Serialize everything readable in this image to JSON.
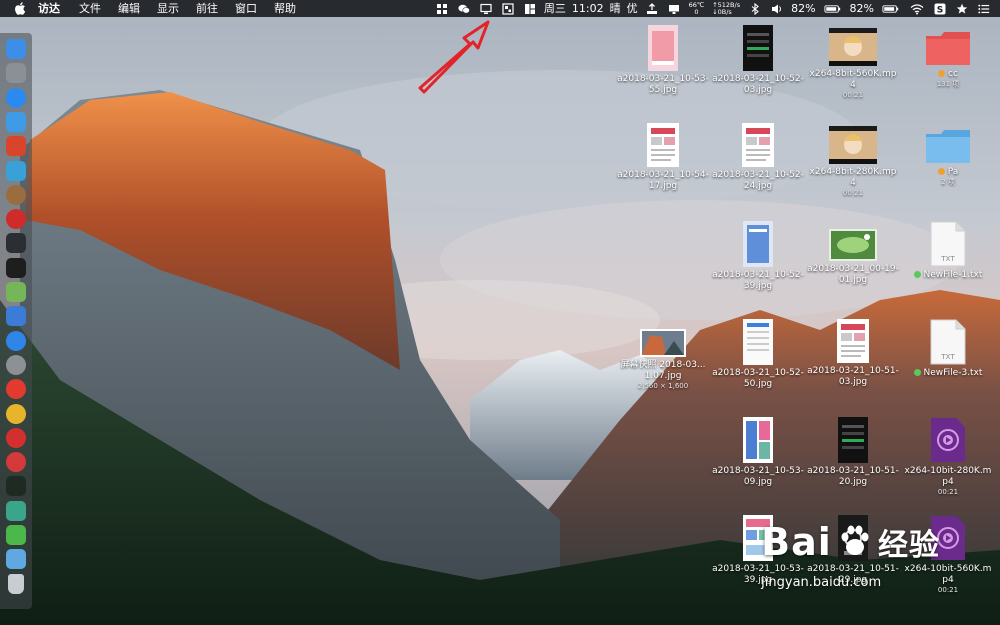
{
  "menubar": {
    "apple_icon": "apple-logo",
    "app_name": "访达",
    "menus": [
      "文件",
      "编辑",
      "显示",
      "前往",
      "窗口",
      "帮助"
    ],
    "status": {
      "day": "周三",
      "time": "11:02",
      "weather": "晴",
      "air": "优",
      "cpu_temp": "66℃",
      "cpu_value": "0",
      "net_up": "↑512B/s",
      "net_down": "↓0B/s",
      "battery_percent_1": "82%",
      "battery_percent_2": "82%"
    }
  },
  "dock": {
    "items": [
      {
        "name": "finder",
        "color": "#3d8ee6"
      },
      {
        "name": "launchpad",
        "color": "#8b8f96"
      },
      {
        "name": "safari",
        "color": "#2b8af2"
      },
      {
        "name": "preview",
        "color": "#3e9be8"
      },
      {
        "name": "app-red",
        "color": "#d8442c"
      },
      {
        "name": "app-blue",
        "color": "#39a1d8"
      },
      {
        "name": "app-brown",
        "color": "#9a6c3e"
      },
      {
        "name": "app-red-2",
        "color": "#cf2b2b"
      },
      {
        "name": "activity-monitor",
        "color": "#2b2f33"
      },
      {
        "name": "terminal",
        "color": "#1e1e1e"
      },
      {
        "name": "maps",
        "color": "#77b55a"
      },
      {
        "name": "app-blue-2",
        "color": "#3a7cd6"
      },
      {
        "name": "app-store",
        "color": "#2f86e8"
      },
      {
        "name": "system-preferences",
        "color": "#8d9196"
      },
      {
        "name": "yandex",
        "color": "#e23a2e"
      },
      {
        "name": "chrome",
        "color": "#e6b52c"
      },
      {
        "name": "netease-music",
        "color": "#d42f2f"
      },
      {
        "name": "vivaldi",
        "color": "#d53a3a"
      },
      {
        "name": "terminal-2",
        "color": "#1f2b22"
      },
      {
        "name": "app-teal",
        "color": "#3aa58b"
      },
      {
        "name": "wechat",
        "color": "#4cb84c"
      },
      {
        "name": "folder",
        "color": "#5fa8e0"
      },
      {
        "name": "trash",
        "color": "#c9cdd2"
      }
    ]
  },
  "desktop": {
    "items": [
      {
        "id": "img1",
        "label": "a2018-03-21_10-53-55.jpg",
        "sub": ""
      },
      {
        "id": "img2",
        "label": "a2018-03-21_10-52-03.jpg",
        "sub": ""
      },
      {
        "id": "vid1",
        "label": "x264-8bit-560K.mp4",
        "sub": "00:21"
      },
      {
        "id": "folder-cc",
        "label": "cc",
        "sub": "131 项"
      },
      {
        "id": "img3",
        "label": "a2018-03-21_10-54-17.jpg",
        "sub": ""
      },
      {
        "id": "img4",
        "label": "a2018-03-21_10-52-24.jpg",
        "sub": ""
      },
      {
        "id": "vid2",
        "label": "x264-8bit-280K.mp4",
        "sub": "00:21"
      },
      {
        "id": "folder-pa",
        "label": "Pa",
        "sub": "2 项"
      },
      {
        "id": "img5",
        "label": "a2018-03-21_10-52-39.jpg",
        "sub": ""
      },
      {
        "id": "img6",
        "label": "a2018-03-21_00-19-01.jpg",
        "sub": ""
      },
      {
        "id": "txt1",
        "label": "NewFile-1.txt",
        "sub": ""
      },
      {
        "id": "shot",
        "label": "屏幕快照 2018-03...1.07.jpg",
        "sub": "2,560 × 1,600"
      },
      {
        "id": "img7",
        "label": "a2018-03-21_10-52-50.jpg",
        "sub": ""
      },
      {
        "id": "img8",
        "label": "a2018-03-21_10-51-03.jpg",
        "sub": ""
      },
      {
        "id": "txt2",
        "label": "NewFile-3.txt",
        "sub": ""
      },
      {
        "id": "img9",
        "label": "a2018-03-21_10-53-09.jpg",
        "sub": ""
      },
      {
        "id": "img10",
        "label": "a2018-03-21_10-51-20.jpg",
        "sub": ""
      },
      {
        "id": "vid3",
        "label": "x264-10bit-280K.mp4",
        "sub": "00:21"
      },
      {
        "id": "img11",
        "label": "a2018-03-21_10-53-39.jpg",
        "sub": ""
      },
      {
        "id": "img12",
        "label": "a2018-03-21_10-51-29.jpg",
        "sub": ""
      },
      {
        "id": "vid4",
        "label": "x264-10bit-560K.mp4",
        "sub": "00:21"
      }
    ],
    "txt_badge": "TXT",
    "tag_colors": {
      "orange": "#f0a033",
      "green": "#5ac85a"
    }
  },
  "watermark": {
    "main": "Bai",
    "cn": "经验",
    "url": "jingyan.baidu.com"
  },
  "annotation": {
    "arrow_color": "#e0242a"
  }
}
